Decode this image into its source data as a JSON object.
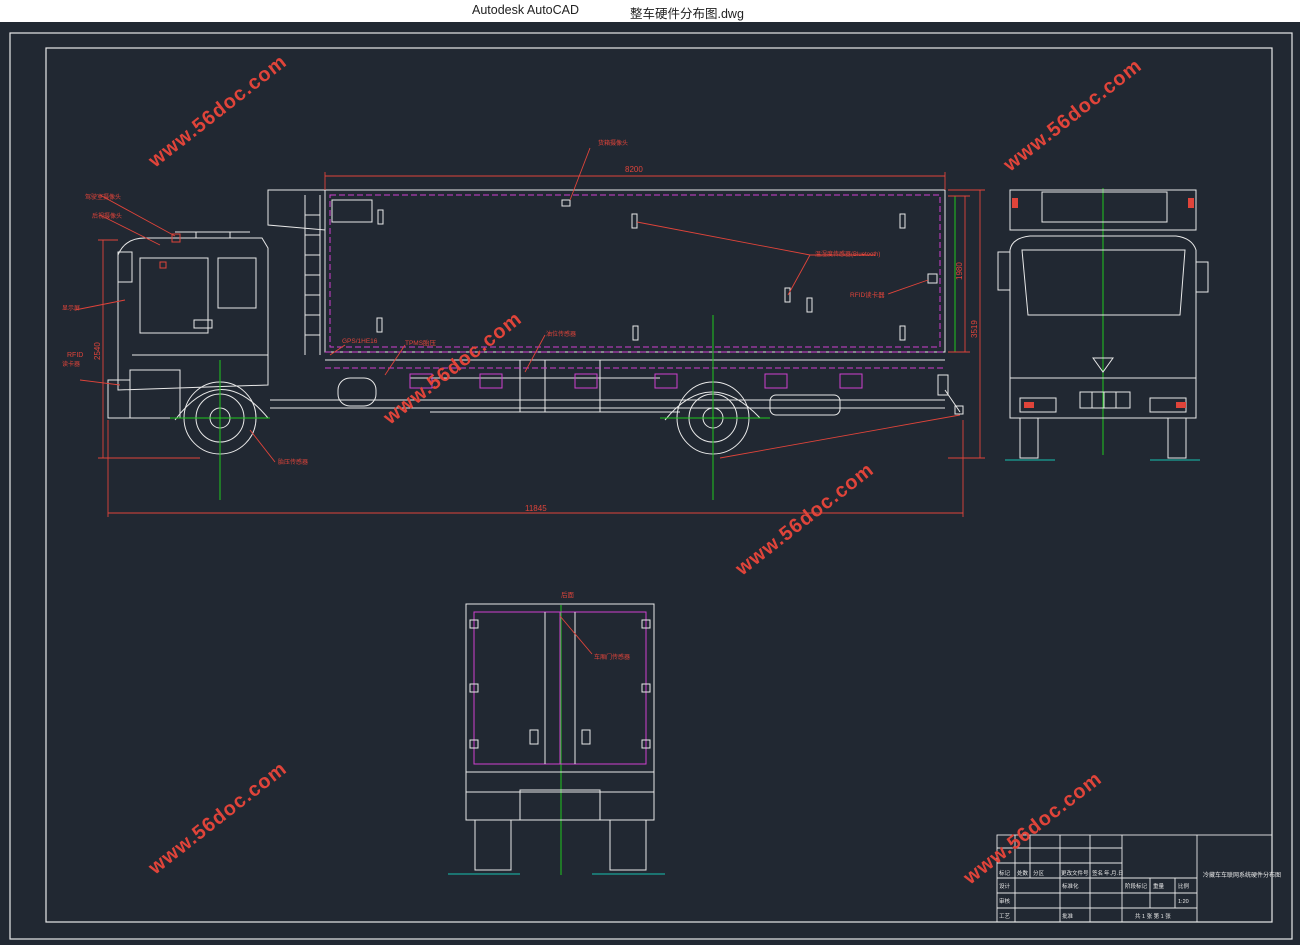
{
  "window": {
    "app_title": "Autodesk AutoCAD",
    "document_title": "整车硬件分布图.dwg"
  },
  "drawing": {
    "dim_length_total": "11845",
    "dim_box_length": "8200",
    "dim_box_height": "1980",
    "dim_total_height": "3519",
    "dim_cab_height": "2540",
    "label_door_view": "后面",
    "label_gps": "GPS/1HE16",
    "label_tpms": "TPMS胎压",
    "label_rfid_box": "RFID读卡器",
    "label_rfid_cab": "RFID",
    "label_temp_sensor": "温湿度传感器(Bluetooth)",
    "label_door_sensor": "车厢门传感器",
    "label_roof_cam": "货箱摄像头",
    "label_cab_cam1": "驾驶室摄像头",
    "label_cab_cam2": "后视摄像头",
    "label_screen": "显示屏",
    "label_reader": "读卡器",
    "label_tyre": "胎压传感器",
    "label_side_sensor": "油位传感器",
    "watermark": "www.56doc.com"
  },
  "title_block": {
    "drawing_name": "冷藏车车联网系统硬件分布图",
    "scale": "1:20",
    "sheet_info": "共 1 张 第 1 张",
    "row_labels": [
      "标记",
      "设计",
      "审核",
      "工艺"
    ],
    "header_cells": [
      "标记",
      "处数",
      "分区",
      "更改文件号",
      "签名",
      "年.月.日"
    ],
    "stage_label": "阶段标记",
    "weight_label": "重量",
    "scale_label": "比例",
    "std_label": "标准化",
    "approve_label": "批准"
  },
  "colors": {
    "outline": "#e8e8e8",
    "dimension": "#e0443a",
    "center": "#1ec81e",
    "sensor_box": "#d040d0",
    "ground": "#18c0b0"
  }
}
